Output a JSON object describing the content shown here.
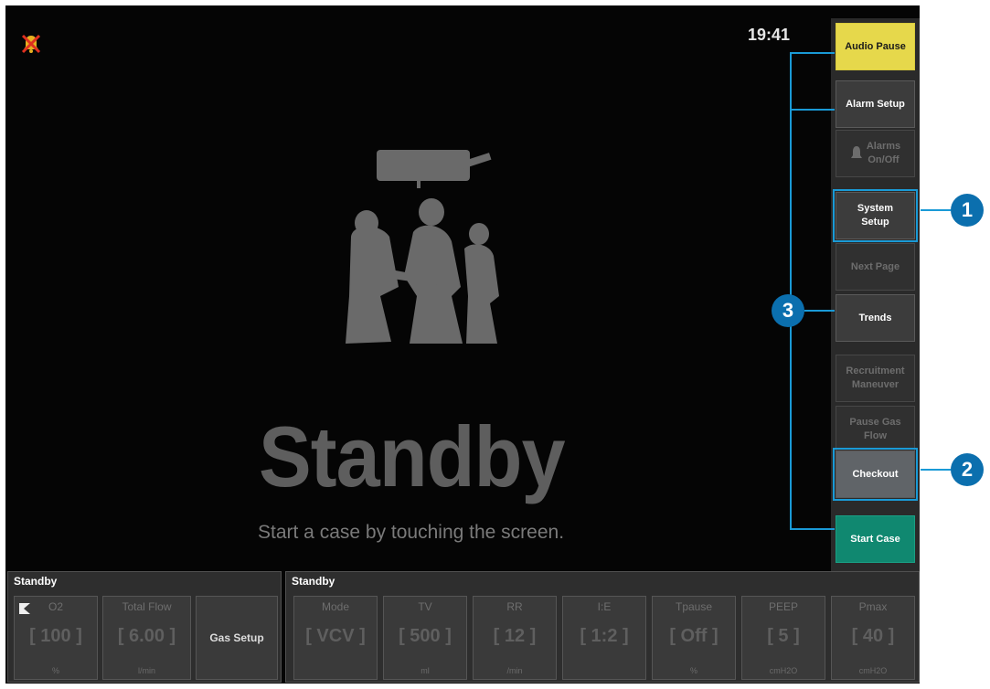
{
  "clock": "19:41",
  "standby": {
    "title": "Standby",
    "subtitle": "Start a case by touching the screen."
  },
  "menu": {
    "audio_pause": "Audio Pause",
    "alarm_setup": "Alarm Setup",
    "alarms_onoff": "Alarms\nOn/Off",
    "system_setup": "System\nSetup",
    "next_page": "Next Page",
    "trends": "Trends",
    "recruitment": "Recruitment\nManeuver",
    "pause_gas": "Pause Gas\nFlow",
    "checkout": "Checkout",
    "start_case": "Start Case"
  },
  "gas_panel": {
    "header": "Standby",
    "o2": {
      "label": "O2",
      "value": "[ 100 ]",
      "unit": "%"
    },
    "total_flow": {
      "label": "Total Flow",
      "value": "[ 6.00 ]",
      "unit": "l/min"
    },
    "gas_setup": "Gas Setup"
  },
  "vent_panel": {
    "header": "Standby",
    "params": [
      {
        "label": "Mode",
        "value": "[ VCV ]",
        "unit": ""
      },
      {
        "label": "TV",
        "value": "[ 500 ]",
        "unit": "ml"
      },
      {
        "label": "RR",
        "value": "[ 12 ]",
        "unit": "/min"
      },
      {
        "label": "I:E",
        "value": "[ 1:2 ]",
        "unit": ""
      },
      {
        "label": "Tpause",
        "value": "[ Off ]",
        "unit": "%"
      },
      {
        "label": "PEEP",
        "value": "[ 5 ]",
        "unit": "cmH2O"
      },
      {
        "label": "Pmax",
        "value": "[ 40 ]",
        "unit": "cmH2O"
      }
    ]
  },
  "annotations": {
    "one": "1",
    "two": "2",
    "three": "3"
  },
  "colors": {
    "accent_yellow": "#e6d84b",
    "start_green": "#108870",
    "callout_blue": "#0b6fae",
    "highlight": "#1a9ad6"
  },
  "icons": {
    "alarm": "alarm-silenced-icon",
    "alarms_toggle": "alarm-bell-icon",
    "o2_flush": "flag-icon"
  }
}
